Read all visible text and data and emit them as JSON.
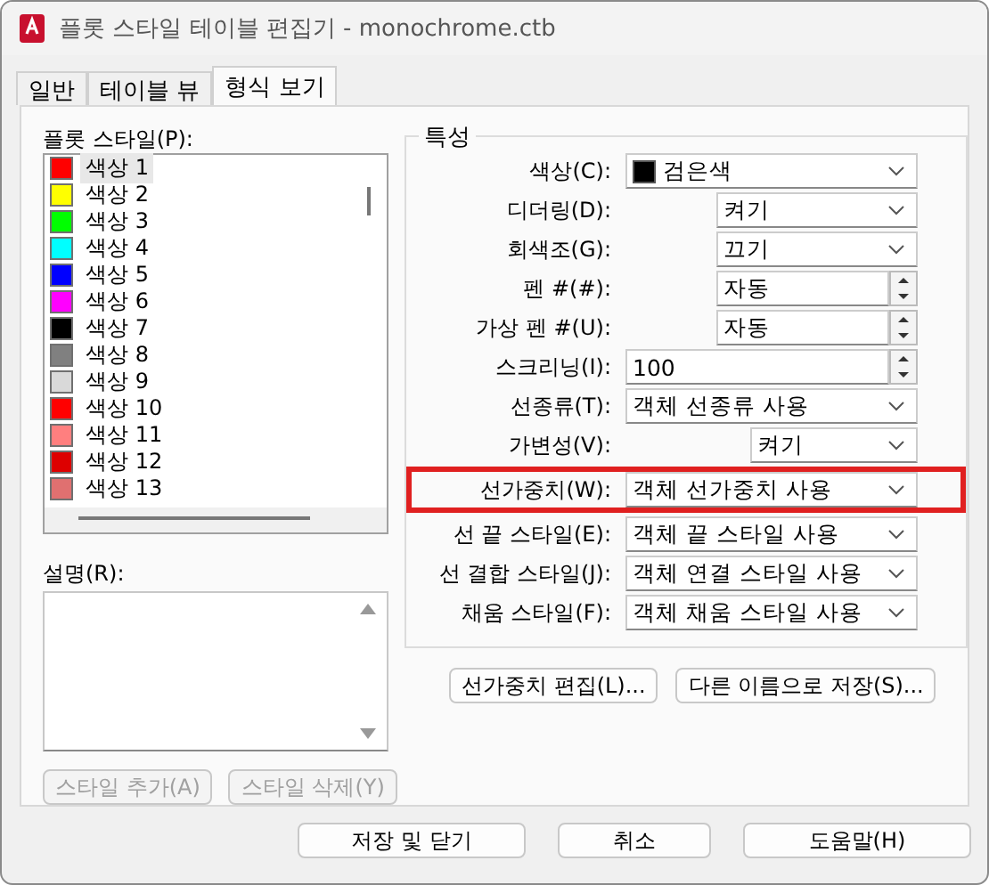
{
  "window": {
    "title": "플롯 스타일 테이블 편집기 - monochrome.ctb"
  },
  "tabs": [
    {
      "label": "일반",
      "selected": false
    },
    {
      "label": "테이블 뷰",
      "selected": false
    },
    {
      "label": "형식 보기",
      "selected": true
    }
  ],
  "plot_styles": {
    "label": "플롯 스타일(P):",
    "items": [
      {
        "name": "색상 1",
        "color": "#ff0000",
        "selected": true
      },
      {
        "name": "색상 2",
        "color": "#ffff00",
        "selected": false
      },
      {
        "name": "색상 3",
        "color": "#00ff00",
        "selected": false
      },
      {
        "name": "색상 4",
        "color": "#00ffff",
        "selected": false
      },
      {
        "name": "색상 5",
        "color": "#0000ff",
        "selected": false
      },
      {
        "name": "색상 6",
        "color": "#ff00ff",
        "selected": false
      },
      {
        "name": "색상 7",
        "color": "#000000",
        "selected": false
      },
      {
        "name": "색상 8",
        "color": "#808080",
        "selected": false
      },
      {
        "name": "색상 9",
        "color": "#d9d9d9",
        "selected": false
      },
      {
        "name": "색상 10",
        "color": "#ff0000",
        "selected": false
      },
      {
        "name": "색상 11",
        "color": "#ff7f7f",
        "selected": false
      },
      {
        "name": "색상 12",
        "color": "#dd0000",
        "selected": false
      },
      {
        "name": "색상 13",
        "color": "#e07070",
        "selected": false
      }
    ]
  },
  "description": {
    "label": "설명(R):"
  },
  "style_buttons": [
    {
      "label": "스타일 추가(A)",
      "disabled": true
    },
    {
      "label": "스타일 삭제(Y)",
      "disabled": true
    }
  ],
  "properties": {
    "title": "특성",
    "fields": [
      {
        "kind": "combo",
        "label": "색상(C):",
        "value": "검은색",
        "color": "#000000",
        "highlighted": false
      },
      {
        "kind": "combo",
        "label": "디더링(D):",
        "value": "켜기",
        "highlighted": false
      },
      {
        "kind": "combo",
        "label": "회색조(G):",
        "value": "끄기",
        "highlighted": false
      },
      {
        "kind": "spin",
        "label": "펜 #(#):",
        "value": "자동",
        "highlighted": false
      },
      {
        "kind": "spin",
        "label": "가상 펜 #(U):",
        "value": "자동",
        "highlighted": false
      },
      {
        "kind": "spin",
        "label": "스크리닝(I):",
        "value": "100",
        "highlighted": false
      },
      {
        "kind": "combo",
        "label": "선종류(T):",
        "value": "객체 선종류 사용",
        "highlighted": false
      },
      {
        "kind": "combo",
        "label": "가변성(V):",
        "value": "켜기",
        "highlighted": false
      },
      {
        "kind": "combo",
        "label": "선가중치(W):",
        "value": "객체 선가중치 사용",
        "highlighted": true
      },
      {
        "kind": "combo",
        "label": "선 끝 스타일(E):",
        "value": "객체 끝 스타일 사용",
        "highlighted": false
      },
      {
        "kind": "combo",
        "label": "선 결합 스타일(J):",
        "value": "객체 연결 스타일 사용",
        "highlighted": false
      },
      {
        "kind": "combo",
        "label": "채움 스타일(F):",
        "value": "객체 채움 스타일 사용",
        "highlighted": false
      }
    ]
  },
  "property_buttons": [
    "선가중치 편집(L)...",
    "다른 이름으로 저장(S)..."
  ],
  "dialog_buttons": [
    "저장 및 닫기",
    "취소",
    "도움말(H)"
  ]
}
